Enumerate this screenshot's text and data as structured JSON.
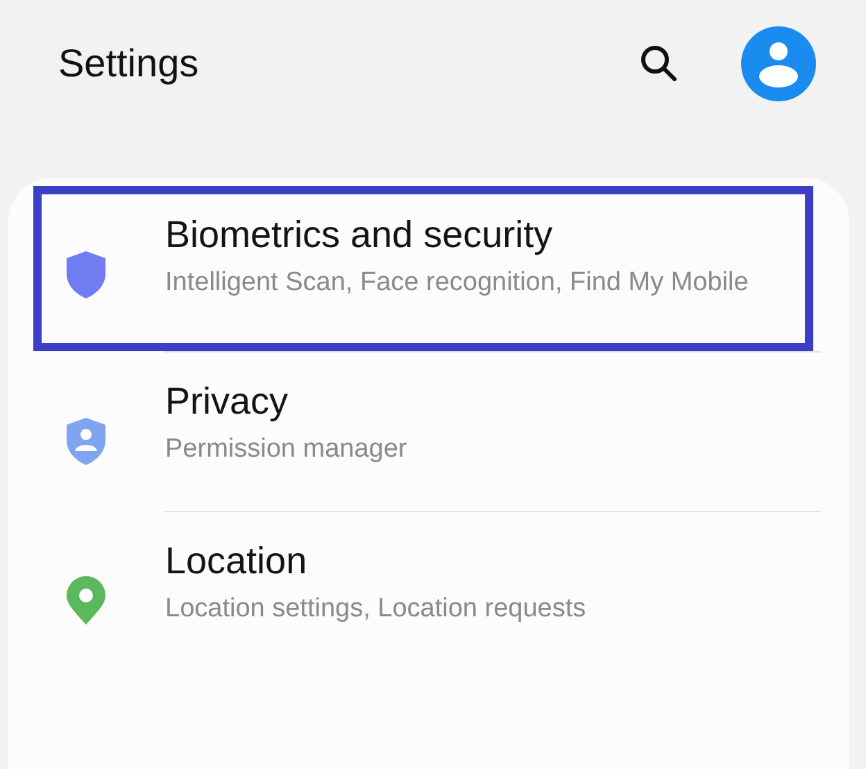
{
  "header": {
    "title": "Settings"
  },
  "items": [
    {
      "kind": "shield",
      "color": "#6f7cf2",
      "title": "Biometrics and security",
      "subtitle": "Intelligent Scan, Face recognition, Find My Mobile",
      "highlighted": true
    },
    {
      "kind": "privacy",
      "color": "#7fa4f0",
      "title": "Privacy",
      "subtitle": "Permission manager",
      "highlighted": false
    },
    {
      "kind": "location",
      "color": "#5cb85c",
      "title": "Location",
      "subtitle": "Location settings, Location requests",
      "highlighted": false
    }
  ]
}
